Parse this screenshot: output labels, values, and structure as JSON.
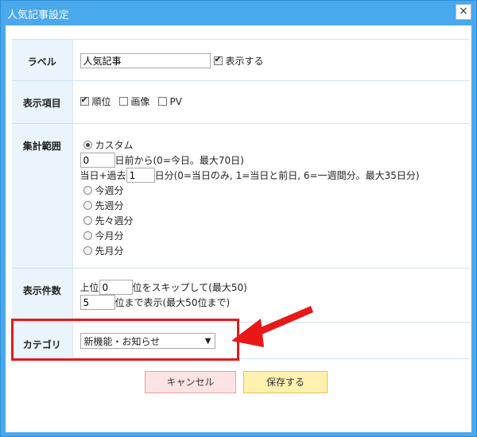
{
  "window": {
    "title": "人気記事設定",
    "close_icon": "×"
  },
  "label_row": {
    "header": "ラベル",
    "value": "人気記事",
    "show_checked": true,
    "show_label": "表示する"
  },
  "items_row": {
    "header": "表示項目",
    "options": [
      {
        "label": "順位",
        "checked": true
      },
      {
        "label": "画像",
        "checked": false
      },
      {
        "label": "PV",
        "checked": false
      }
    ]
  },
  "range_row": {
    "header": "集計範囲",
    "custom_label": "カスタム",
    "days_before_value": "0",
    "days_before_text": "日前から(0=今日。最大70日)",
    "today_past_label": "当日+過去",
    "days_value": "1",
    "days_text": "日分(0=当日のみ, 1=当日と前日, 6=一週間分。最大35日分)",
    "options": [
      "今週分",
      "先週分",
      "先々週分",
      "今月分",
      "先月分"
    ]
  },
  "count_row": {
    "header": "表示件数",
    "top_label": "上位",
    "skip_value": "0",
    "skip_text": "位をスキップして(最大50)",
    "show_value": "5",
    "show_text": "位まで表示(最大50位まで)"
  },
  "category_row": {
    "header": "カテゴリ",
    "selected": "新機能・お知らせ"
  },
  "buttons": {
    "cancel": "キャンセル",
    "save": "保存する"
  },
  "colors": {
    "titlebar": "#4aa8ec",
    "highlight": "#e81818",
    "cancel_bg": "#fde3e3",
    "save_bg": "#fff2b0"
  }
}
